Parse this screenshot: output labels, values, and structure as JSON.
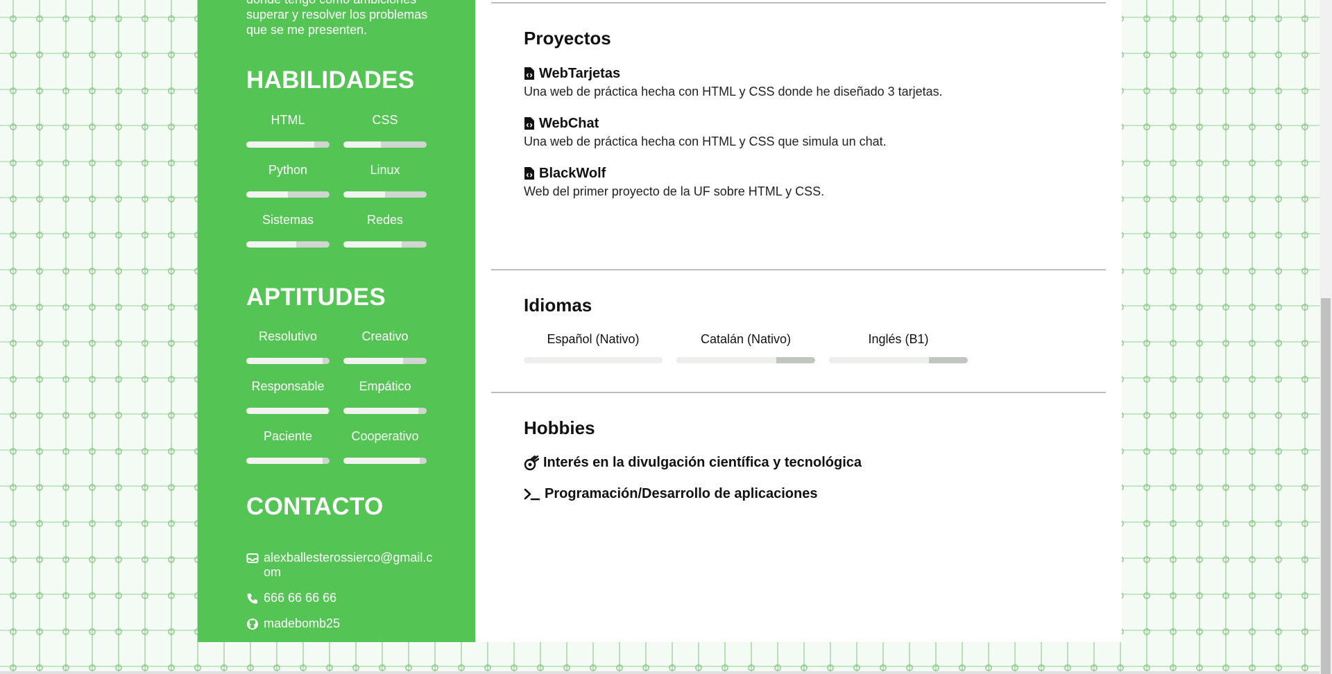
{
  "sidebar": {
    "intro_lines": [
      "donde tengo como ambiciones",
      "superar y resolver los problemas",
      "que se me presenten."
    ],
    "skills_title": "HABILIDADES",
    "skills": [
      {
        "label": "HTML",
        "level": 0.82
      },
      {
        "label": "CSS",
        "level": 0.45
      },
      {
        "label": "Python",
        "level": 0.5
      },
      {
        "label": "Linux",
        "level": 0.5
      },
      {
        "label": "Sistemas",
        "level": 0.6
      },
      {
        "label": "Redes",
        "level": 0.7
      }
    ],
    "aptitudes_title": "APTITUDES",
    "aptitudes": [
      {
        "label": "Resolutivo",
        "level": 0.92
      },
      {
        "label": "Creativo",
        "level": 0.72
      },
      {
        "label": "Responsable",
        "level": 0.98
      },
      {
        "label": "Empático",
        "level": 0.9
      },
      {
        "label": "Paciente",
        "level": 0.92
      },
      {
        "label": "Cooperativo",
        "level": 0.92
      }
    ],
    "contact_title": "CONTACTO",
    "contact": {
      "email": "alexballesterossierco@gmail.com",
      "phone": "666 66 66 66",
      "github": "madebomb25"
    }
  },
  "main": {
    "projects_title": "Proyectos",
    "projects": [
      {
        "name": "WebTarjetas",
        "desc": "Una web de práctica hecha con HTML y CSS donde he diseñado 3 tarjetas."
      },
      {
        "name": "WebChat",
        "desc": "Una web de práctica hecha con HTML y CSS que simula un chat."
      },
      {
        "name": "BlackWolf",
        "desc": "Web del primer proyecto de la UF sobre HTML y CSS."
      }
    ],
    "languages_title": "Idiomas",
    "languages": [
      {
        "label": "Español (Nativo)",
        "level": 1.0
      },
      {
        "label": "Catalán (Nativo)",
        "level": 0.72
      },
      {
        "label": "Inglés (B1)",
        "level": 0.72
      }
    ],
    "hobbies_title": "Hobbies",
    "hobbies": [
      {
        "label": "Interés en la divulgación científica y tecnológica",
        "icon": "meteor-icon"
      },
      {
        "label": "Programación/Desarrollo de aplicaciones",
        "icon": "terminal-icon"
      }
    ]
  },
  "colors": {
    "sidebar_bg": "#54c454",
    "background_pattern": "#6ebe6e"
  }
}
